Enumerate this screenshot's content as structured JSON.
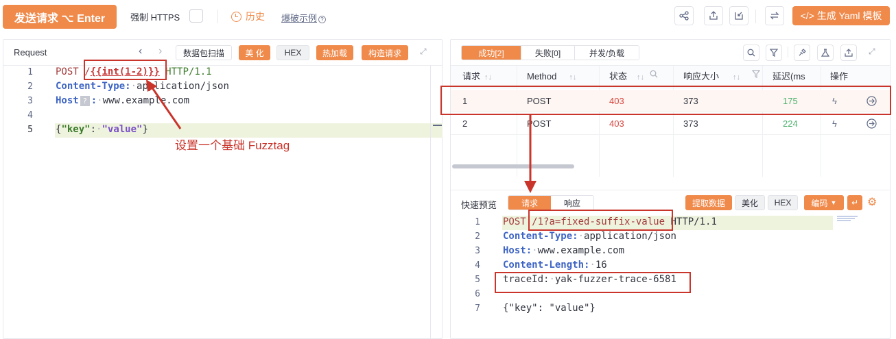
{
  "toolbar": {
    "send_label": "发送请求 ⌥ Enter",
    "force_https_label": "强制 HTTPS",
    "history_label": "历史",
    "fuzz_example_label": "爆破示例",
    "qmark": "?",
    "generate_yaml_label": "</> 生成 Yaml 模板",
    "icons": [
      "share-icon",
      "export-icon",
      "import-icon",
      "swap-icon"
    ]
  },
  "request_panel": {
    "title": "Request",
    "buttons": [
      "数据包扫描",
      "美 化",
      "HEX",
      "热加载",
      "构造请求"
    ],
    "lines": [
      {
        "n": "1",
        "method": "POST",
        "path_prefix": "/",
        "fuzztag": "{{int(1-2)}}",
        "rest": " HTTP/1.1"
      },
      {
        "n": "2",
        "key": "Content-Type:",
        "value": "application/json"
      },
      {
        "n": "3",
        "key": "Host",
        "badge": "?",
        "sep": ":",
        "value": "www.example.com"
      },
      {
        "n": "4"
      },
      {
        "n": "5",
        "body_open": "{",
        "body_key": "\"key\"",
        "body_colon": ":",
        "body_val": "\"value\"",
        "body_close": "}"
      }
    ],
    "annotation": "设置一个基础 Fuzztag"
  },
  "results_panel": {
    "tabs": [
      "成功[2]",
      "失败[0]",
      "并发/负载"
    ],
    "columns": [
      "请求",
      "Method",
      "状态",
      "响应大小",
      "延迟(ms",
      "操作"
    ],
    "rows": [
      {
        "id": "1",
        "method": "POST",
        "status": "403",
        "size": "373",
        "latency": "175"
      },
      {
        "id": "2",
        "method": "POST",
        "status": "403",
        "size": "373",
        "latency": "224"
      }
    ],
    "colors": {
      "status": "#d9453f",
      "latency": "#4cb06c"
    }
  },
  "preview_panel": {
    "title": "快速预览",
    "tabs": [
      "请求",
      "响应"
    ],
    "buttons": [
      "提取数据",
      "美化",
      "HEX",
      "编码"
    ],
    "lines": [
      {
        "n": "1",
        "method": "POST",
        "path": "/1?a=fixed-suffix-value",
        "rest": " HTTP/1.1"
      },
      {
        "n": "2",
        "key": "Content-Type:",
        "value": "application/json"
      },
      {
        "n": "3",
        "key": "Host:",
        "value": "www.example.com"
      },
      {
        "n": "4",
        "key": "Content-Length:",
        "value": "16"
      },
      {
        "n": "5",
        "key": "traceId:",
        "value": "yak-fuzzer-trace-6581"
      },
      {
        "n": "6"
      },
      {
        "n": "7",
        "body": "{\"key\": \"value\"}"
      }
    ]
  },
  "accent": "#f08a4b",
  "annotation_color": "#c9342b"
}
